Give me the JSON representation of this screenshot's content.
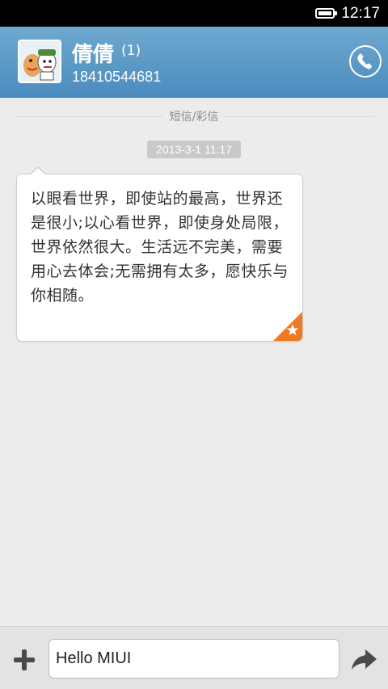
{
  "status_bar": {
    "time": "12:17",
    "battery_icon": "battery-full-icon"
  },
  "header": {
    "name": "倩倩",
    "unread": "(1)",
    "number": "18410544681",
    "avatar_icon": "cartoon-avatar",
    "call_icon": "phone-icon"
  },
  "conversation": {
    "divider_label": "短信/彩信",
    "timestamp": "2013-3-1 11:17",
    "message": "以眼看世界，即使站的最高，世界还是很小;以心看世界，即使身处局限，世界依然很大。生活远不完美，需要用心去体会;无需拥有太多，愿快乐与你相随。",
    "star_icon": "star-icon"
  },
  "input_bar": {
    "value": "Hello MIUI",
    "add_icon": "plus-icon",
    "send_icon": "send-arrow-icon"
  },
  "colors": {
    "header": "#5c9bc7",
    "star_corner": "#f07820",
    "background": "#ececec"
  }
}
